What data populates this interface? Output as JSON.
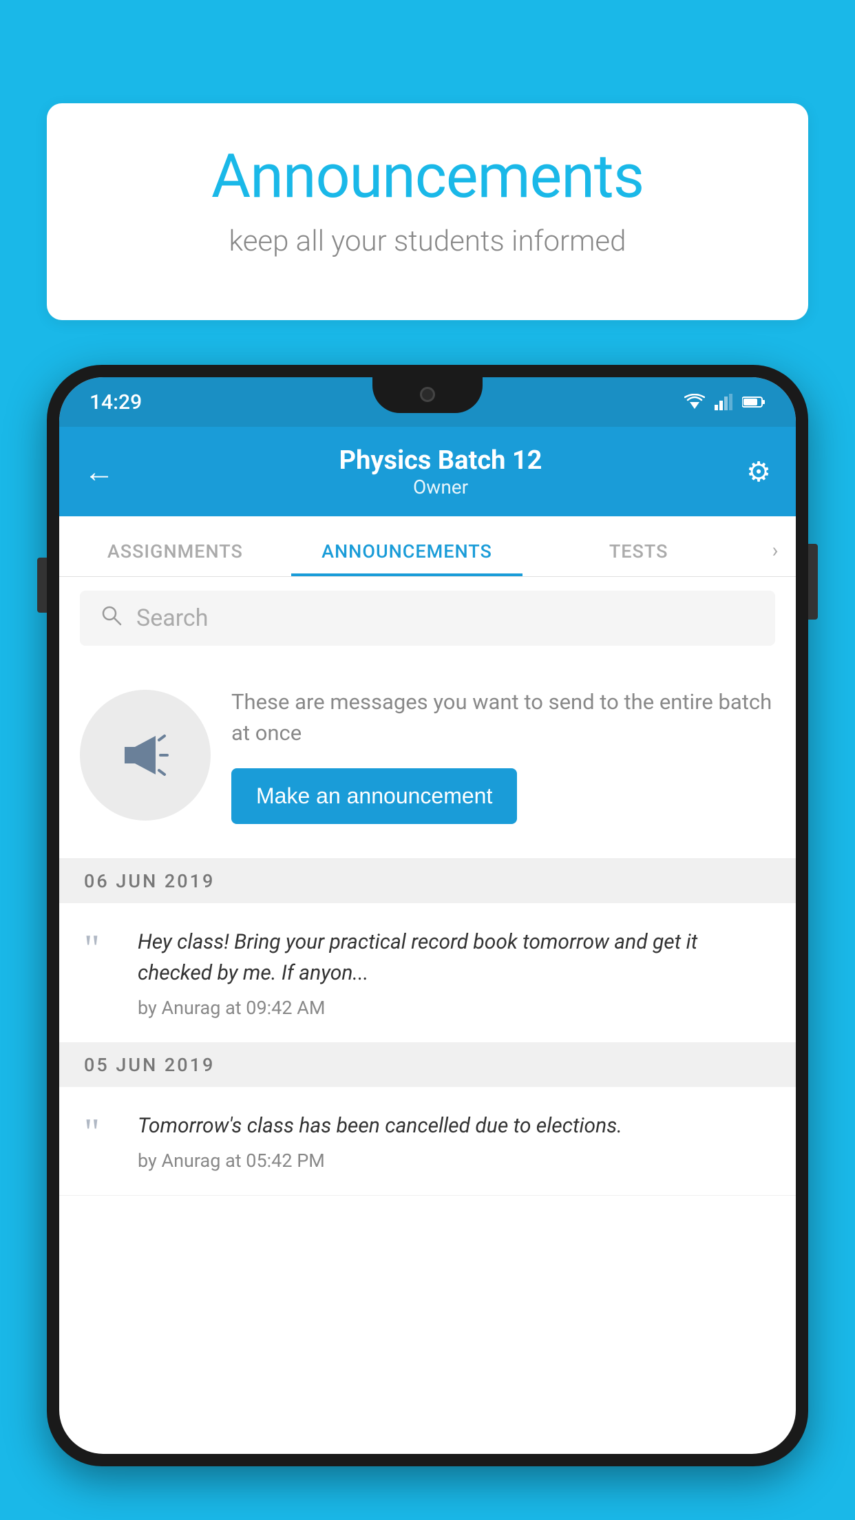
{
  "bubble": {
    "title": "Announcements",
    "subtitle": "keep all your students informed"
  },
  "status_bar": {
    "time": "14:29"
  },
  "app_bar": {
    "title": "Physics Batch 12",
    "subtitle": "Owner",
    "back_label": "←",
    "settings_label": "⚙"
  },
  "tabs": [
    {
      "label": "ASSIGNMENTS",
      "active": false
    },
    {
      "label": "ANNOUNCEMENTS",
      "active": true
    },
    {
      "label": "TESTS",
      "active": false
    }
  ],
  "search": {
    "placeholder": "Search"
  },
  "announcement_prompt": {
    "description": "These are messages you want to send to the entire batch at once",
    "button_label": "Make an announcement"
  },
  "date_sections": [
    {
      "date": "06  JUN  2019",
      "items": [
        {
          "text": "Hey class! Bring your practical record book tomorrow and get it checked by me. If anyon...",
          "meta": "by Anurag at 09:42 AM"
        }
      ]
    },
    {
      "date": "05  JUN  2019",
      "items": [
        {
          "text": "Tomorrow's class has been cancelled due to elections.",
          "meta": "by Anurag at 05:42 PM"
        }
      ]
    }
  ],
  "colors": {
    "primary": "#1a9cd8",
    "background": "#1ab8e8",
    "active_tab": "#1a9cd8"
  }
}
